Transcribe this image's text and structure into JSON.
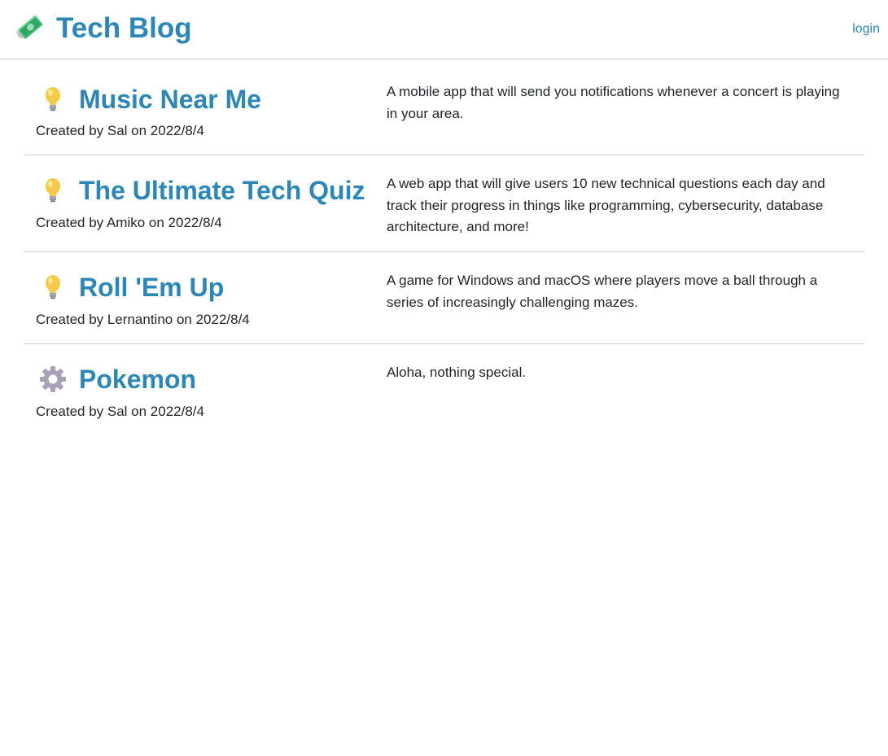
{
  "header": {
    "logo_icon": "money-wings-icon",
    "title": "Tech Blog",
    "login_label": "login"
  },
  "colors": {
    "accent": "#2b87b8",
    "text": "#212529",
    "divider": "#c8c8c8"
  },
  "posts": [
    {
      "icon": "lightbulb-icon",
      "title": "Music Near Me",
      "meta": "Created by Sal on 2022/8/4",
      "description": "A mobile app that will send you notifications whenever a concert is playing in your area."
    },
    {
      "icon": "lightbulb-icon",
      "title": "The Ultimate Tech Quiz",
      "meta": "Created by Amiko on 2022/8/4",
      "description": "A web app that will give users 10 new technical questions each day and track their progress in things like programming, cybersecurity, database architecture, and more!"
    },
    {
      "icon": "lightbulb-icon",
      "title": "Roll 'Em Up",
      "meta": "Created by Lernantino on 2022/8/4",
      "description": "A game for Windows and macOS where players move a ball through a series of increasingly challenging mazes."
    },
    {
      "icon": "gear-icon",
      "title": "Pokemon",
      "meta": "Created by Sal on 2022/8/4",
      "description": "Aloha, nothing special."
    }
  ]
}
